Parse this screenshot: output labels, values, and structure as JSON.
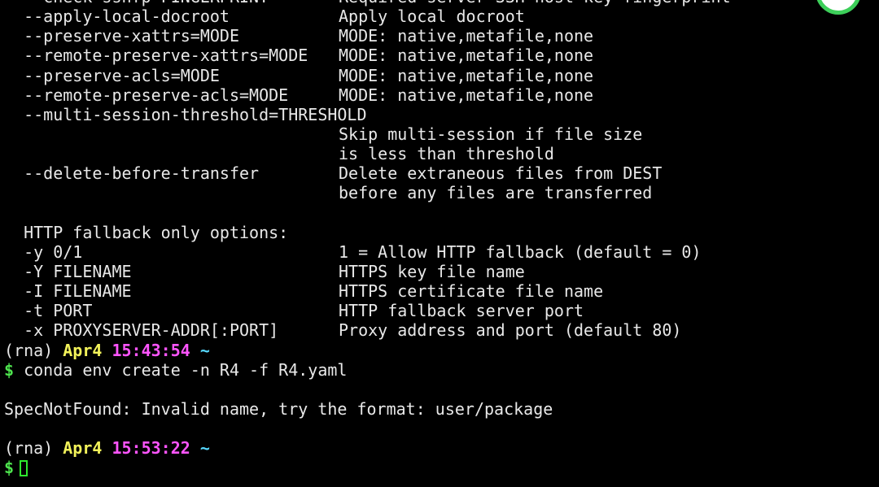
{
  "window": {
    "background_color": "#000000",
    "text_color": "#e8e8e8"
  },
  "options_section": {
    "rows": [
      {
        "flag": "  --check-sshfp=FINGERPRINT",
        "desc": "Required server SSH host key fingerprint"
      },
      {
        "flag": "  --apply-local-docroot",
        "desc": "Apply local docroot"
      },
      {
        "flag": "  --preserve-xattrs=MODE",
        "desc": "MODE: native,metafile,none"
      },
      {
        "flag": "  --remote-preserve-xattrs=MODE",
        "desc": "MODE: native,metafile,none"
      },
      {
        "flag": "  --preserve-acls=MODE",
        "desc": "MODE: native,metafile,none"
      },
      {
        "flag": "  --remote-preserve-acls=MODE",
        "desc": "MODE: native,metafile,none"
      },
      {
        "flag": "  --multi-session-threshold=THRESHOLD",
        "desc": ""
      },
      {
        "flag": "",
        "desc": "Skip multi-session if file size"
      },
      {
        "flag": "",
        "desc": "is less than threshold"
      },
      {
        "flag": "  --delete-before-transfer",
        "desc": "Delete extraneous files from DEST"
      },
      {
        "flag": "",
        "desc": "before any files are transferred"
      }
    ]
  },
  "http_section": {
    "heading": "  HTTP fallback only options:",
    "rows": [
      {
        "flag": "  -y 0/1",
        "desc": "1 = Allow HTTP fallback (default = 0)"
      },
      {
        "flag": "  -Y FILENAME",
        "desc": "HTTPS key file name"
      },
      {
        "flag": "  -I FILENAME",
        "desc": "HTTPS certificate file name"
      },
      {
        "flag": "  -t PORT",
        "desc": "HTTP fallback server port"
      },
      {
        "flag": "  -x PROXYSERVER-ADDR[:PORT]",
        "desc": "Proxy address and port (default 80)"
      }
    ]
  },
  "session": {
    "prompt1": {
      "env": "(rna) ",
      "date": "Apr4",
      "time": "15:43:54",
      "dir": "~"
    },
    "command1": {
      "symbol": "$",
      "text": " conda env create -n R4 -f R4.yaml"
    },
    "error_message": "SpecNotFound: Invalid name, try the format: user/package",
    "prompt2": {
      "env": "(rna) ",
      "date": "Apr4",
      "time": "15:53:22",
      "dir": "~"
    },
    "command2": {
      "symbol": "$",
      "text": ""
    }
  },
  "colors": {
    "date": "#f2f25a",
    "time": "#ff55ff",
    "dir": "#56d8ff",
    "dollar": "#4ee44e",
    "cursor": "#2ee82e"
  }
}
